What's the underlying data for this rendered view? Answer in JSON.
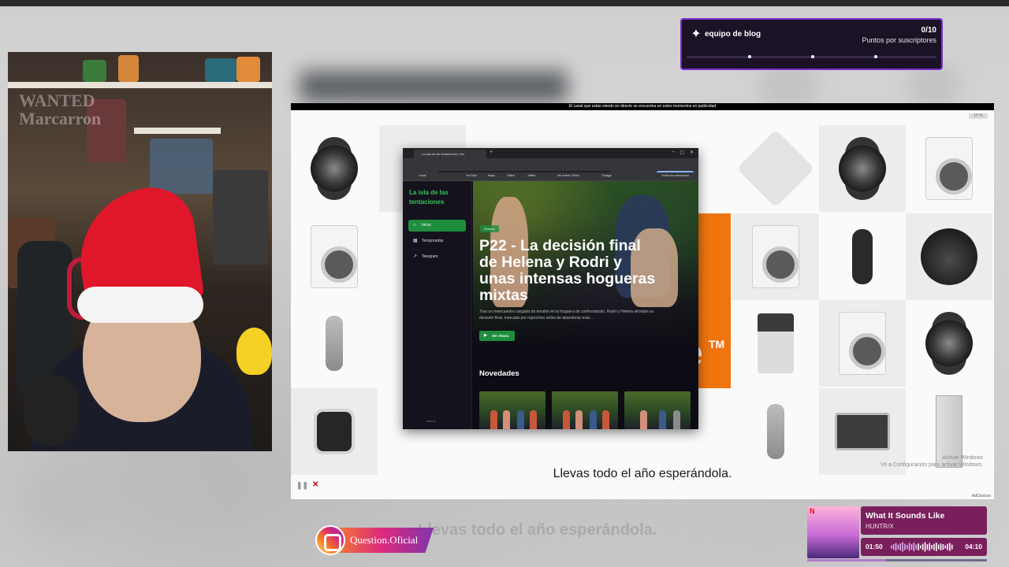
{
  "blog_widget": {
    "name": "equipo de blog",
    "count": "0/10",
    "subtitle": "Puntos por suscriptores",
    "progress": 0
  },
  "player": {
    "notice": "El canal que estás viendo en directo se encuentra en estos momentos en publicidad",
    "subtitle": "Llevas todo el año esperándola.",
    "watermark_line1": "Activar Windows",
    "watermark_line2": "Ve a Configuración para activar Windows.",
    "ad_tag": "AdChoices",
    "percent": "15 %",
    "brand_mark": "e",
    "brand_tm": "TM"
  },
  "browser": {
    "tab_title": "La isla de las tentaciones | Ver",
    "address": "laisla.tv/",
    "update_button": "Relanzar para actualizar",
    "bookmarks": [
      "Gmail",
      "YouTube",
      "Maps",
      "Twitch",
      "Twitter",
      "Ver Anime Online",
      "Chatgpt",
      "Todos los marcadores"
    ]
  },
  "site": {
    "title": "La isla de las tentaciones",
    "nav": [
      {
        "label": "Inicio",
        "icon": "home-icon"
      },
      {
        "label": "Temporadas",
        "icon": "calendar-icon"
      },
      {
        "label": "Telegram",
        "icon": "external-link-icon"
      }
    ],
    "footer": "laisla.tv",
    "hero": {
      "badge": "Estreno",
      "title": "P22 - La decisión final de Helena y Rodri y unas intensas hogueras mixtas",
      "description": "Tras un reencuentro cargado de tensión en la hoguera de confrontación, Rodri y Helena afrontan su decisión final, marcada por reproches antes de abandonar esta...",
      "watch_button": "Ver Ahora"
    },
    "section_title": "Novedades"
  },
  "overlays": {
    "instagram_handle": "Question.Oficial",
    "ghost_text": "Llevas todo el año esperándola."
  },
  "music": {
    "title": "What It Sounds Like",
    "artist": "HUNTR/X",
    "elapsed": "01:50",
    "duration": "04:10",
    "progress": 0.44,
    "cover_brand": "N"
  },
  "colors": {
    "accent_green": "#1e8e3e",
    "widget_purple": "#7a2fd0",
    "music_bg": "#7a1f5c",
    "brand_orange": "#f0750f"
  }
}
